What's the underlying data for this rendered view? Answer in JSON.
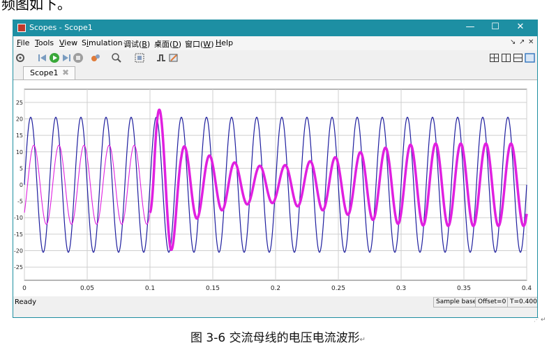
{
  "window": {
    "title": "Scopes - Scope1",
    "controls": [
      "—",
      "☐",
      "✕"
    ]
  },
  "menu": {
    "items": [
      {
        "pre": "",
        "u": "F",
        "post": "ile"
      },
      {
        "pre": "",
        "u": "T",
        "post": "ools"
      },
      {
        "pre": "",
        "u": "V",
        "post": "iew"
      },
      {
        "pre": "S",
        "u": "i",
        "post": "mulation"
      },
      {
        "pre": "调试(",
        "u": "B",
        "post": ")"
      },
      {
        "pre": "桌面(",
        "u": "D",
        "post": ")"
      },
      {
        "pre": "窗口(",
        "u": "W",
        "post": ")"
      },
      {
        "pre": "",
        "u": "H",
        "post": "elp"
      }
    ],
    "dock_icons": [
      "↘",
      "↗",
      "✕"
    ]
  },
  "toolbar": {
    "icons": [
      "settings-icon",
      "step-back-icon",
      "run-icon",
      "step-forward-icon",
      "stop-icon",
      "highlight-icon",
      "zoom-icon",
      "fit-axes-icon",
      "triggers-icon",
      "cursor-measure-icon",
      "layout-grid-icon",
      "layout-columns-icon",
      "layout-rows-icon",
      "layout-single-icon"
    ]
  },
  "tab": {
    "label": "Scope1",
    "close": "✖"
  },
  "status": {
    "ready": "Ready",
    "sample": "Sample based",
    "offset": "Offset=0",
    "time": "T=0.400"
  },
  "caption": "图 3-6 交流母线的电压电流波形",
  "chart_data": {
    "type": "line",
    "xlim": [
      0,
      0.4
    ],
    "ylim": [
      -29,
      29
    ],
    "x_ticks": [
      "0",
      "0.05",
      "0.1",
      "0.15",
      "0.2",
      "0.25",
      "0.3",
      "0.35",
      "0.4"
    ],
    "x_tick_values": [
      0,
      0.05,
      0.1,
      0.15,
      0.2,
      0.25,
      0.3,
      0.35,
      0.4
    ],
    "y_ticks": [
      "25",
      "20",
      "15",
      "10",
      "5",
      "0",
      "-5",
      "-10",
      "-15",
      "-20",
      "-25"
    ],
    "y_tick_values": [
      25,
      20,
      15,
      10,
      5,
      0,
      -5,
      -10,
      -15,
      -20,
      -25
    ],
    "grid": true,
    "series": [
      {
        "color": "#1e1e9e",
        "kind": "sine",
        "amplitude": 20.5,
        "frequency_hz": 50,
        "phase_deg": 0
      },
      {
        "color": "#e020e0",
        "kind": "envelope",
        "frequency_hz": 50,
        "phase_deg": -45,
        "ripple": 1.1,
        "envelope": [
          [
            0,
            12
          ],
          [
            0.1,
            12
          ],
          [
            0.104,
            23.5
          ],
          [
            0.116,
            21
          ],
          [
            0.125,
            12
          ],
          [
            0.15,
            8.5
          ],
          [
            0.175,
            6
          ],
          [
            0.2,
            5.5
          ],
          [
            0.225,
            7
          ],
          [
            0.25,
            8.5
          ],
          [
            0.275,
            10.5
          ],
          [
            0.3,
            12
          ],
          [
            0.325,
            12.5
          ],
          [
            0.35,
            12.5
          ],
          [
            0.375,
            12.5
          ],
          [
            0.4,
            12.5
          ]
        ]
      }
    ]
  }
}
